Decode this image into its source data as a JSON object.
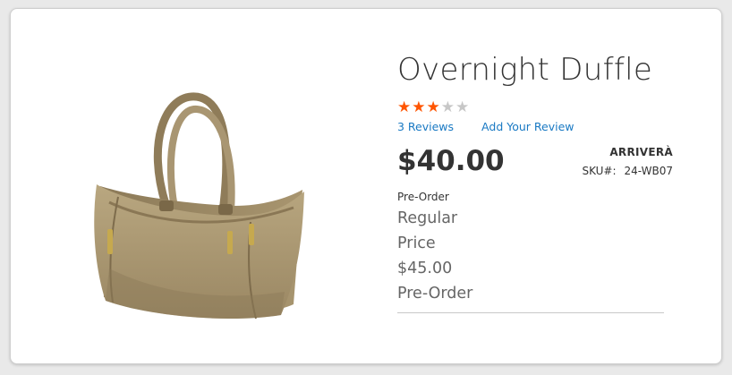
{
  "product": {
    "title": "Overnight Duffle",
    "rating": {
      "stars_filled": 3,
      "stars_total": 5
    },
    "reviews_link": "3 Reviews",
    "add_review_link": "Add Your Review",
    "price": "$40.00",
    "price_note": "Pre-Order",
    "stock_status": "ARRIVERÀ",
    "sku_label": "SKU#:",
    "sku_value": "24-WB07",
    "regular_price": {
      "label_line1": "Regular",
      "label_line2": "Price",
      "amount": "$45.00",
      "note": "Pre-Order"
    }
  },
  "colors": {
    "star_filled": "#ff5501",
    "star_empty": "#c7c7c7",
    "link": "#1979c3",
    "bag": "#a8956f"
  },
  "image": {
    "icon": "duffle-bag-product-photo"
  }
}
